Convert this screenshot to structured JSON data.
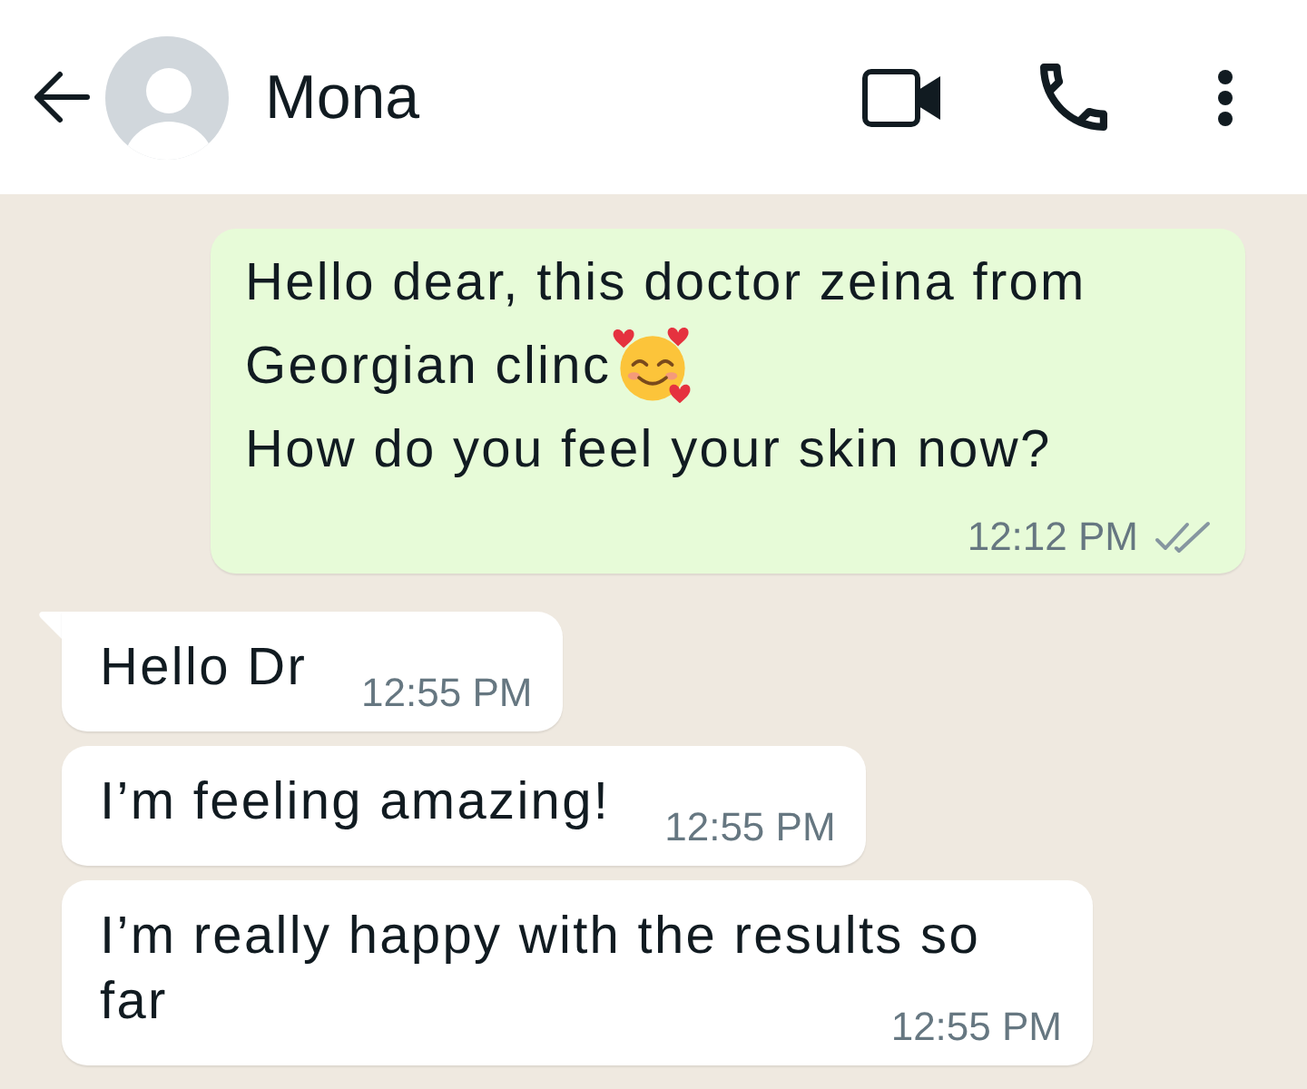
{
  "header": {
    "contact_name": "Mona"
  },
  "messages": [
    {
      "kind": "outgoing",
      "tail": false,
      "parts": [
        {
          "kind": "text",
          "text": "Hello dear, this doctor zeina from"
        },
        {
          "kind": "break"
        },
        {
          "kind": "text",
          "text": "Georgian clinc"
        },
        {
          "kind": "emoji"
        },
        {
          "kind": "break"
        },
        {
          "kind": "text",
          "text": "How do you feel your skin now?"
        }
      ],
      "time": "12:12 PM",
      "read": false
    },
    {
      "kind": "incoming",
      "tail": true,
      "parts": [
        {
          "kind": "text",
          "text": "Hello Dr"
        }
      ],
      "time": "12:55 PM"
    },
    {
      "kind": "incoming",
      "tail": false,
      "parts": [
        {
          "kind": "text",
          "text": "I’m feeling amazing!"
        }
      ],
      "time": "12:55 PM"
    },
    {
      "kind": "incoming",
      "tail": false,
      "parts": [
        {
          "kind": "text",
          "text": "I’m really happy with the results so"
        },
        {
          "kind": "break"
        },
        {
          "kind": "text",
          "text": "far"
        }
      ],
      "time": "12:55 PM"
    }
  ]
}
